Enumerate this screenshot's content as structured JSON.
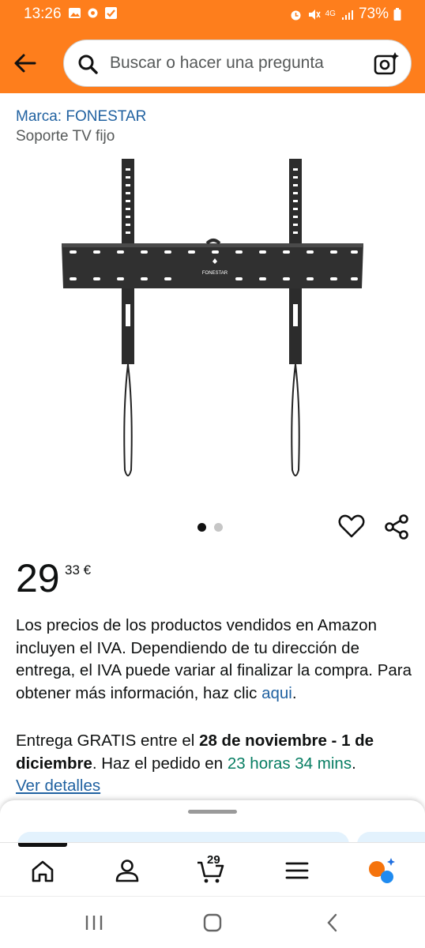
{
  "status_bar": {
    "time": "13:26",
    "network": "4G",
    "battery": "73%"
  },
  "header": {
    "search_placeholder": "Buscar o hacer una pregunta",
    "accent_color": "#fe7e1c"
  },
  "product": {
    "brand": "Marca: FONESTAR",
    "title": "Soporte TV fijo",
    "image_label": "FONESTAR",
    "carousel": {
      "total": 2,
      "active": 1
    },
    "price_whole": "29",
    "price_fraction": "33 €"
  },
  "description": {
    "text": "Los precios de los productos vendidos en Amazon incluyen el IVA. Dependiendo de tu dirección de entrega, el IVA puede variar al finalizar la compra. Para obtener más información, haz clic ",
    "link": "aqui",
    "end": "."
  },
  "delivery": {
    "prefix": "Entrega GRATIS entre el ",
    "dates": "28 de noviembre - 1 de diciembre",
    "middle": ". Haz el pedido en ",
    "time_left": "23 horas 34 mins",
    "end": ".",
    "details_link": "Ver detalles"
  },
  "bottom_nav": {
    "items": [
      "home-icon",
      "account-icon",
      "cart-icon",
      "menu-icon",
      "rufus-icon"
    ],
    "cart_count": "29"
  }
}
